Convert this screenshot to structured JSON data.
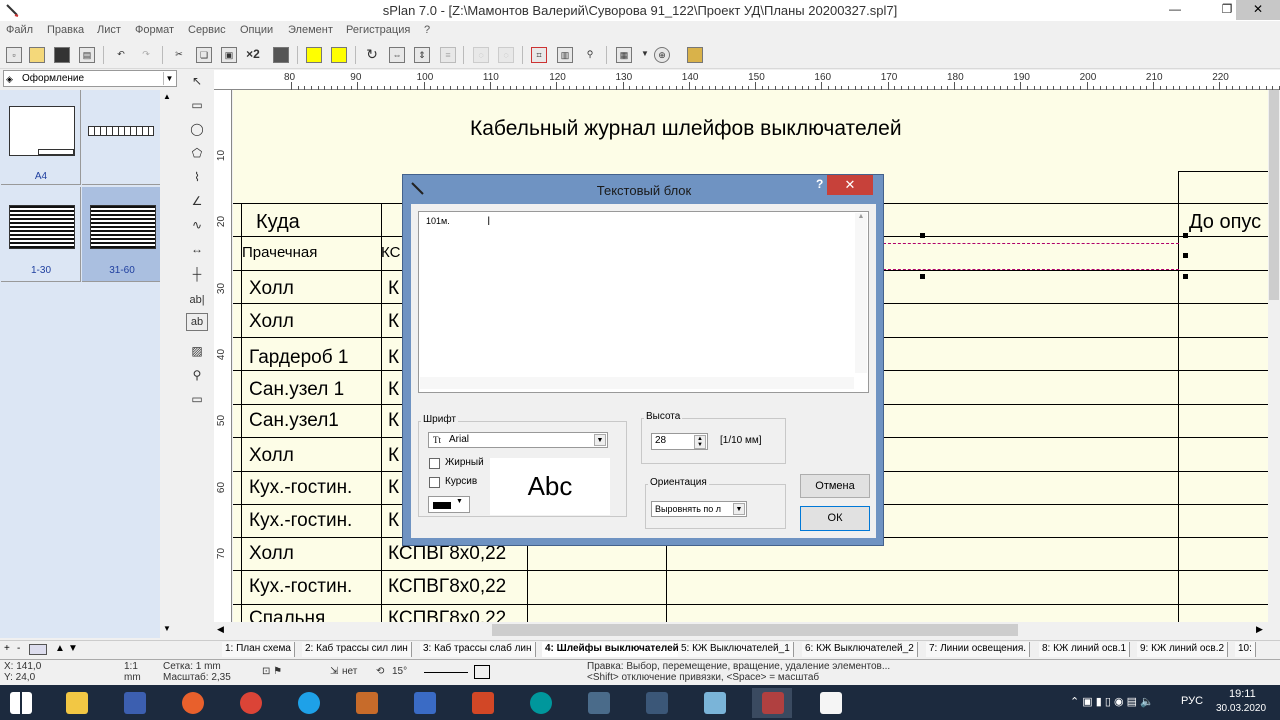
{
  "window": {
    "title": "sPlan 7.0 - [Z:\\Мамонтов Валерий\\Суворова 91_122\\Проект УД\\Планы 20200327.spl7]"
  },
  "menu": [
    "Файл",
    "Правка",
    "Лист",
    "Формат",
    "Сервис",
    "Опции",
    "Элемент",
    "Регистрация",
    "?"
  ],
  "toolbar": {
    "multiply_label": "×2"
  },
  "layer_combo": {
    "value": "Оформление"
  },
  "pages": [
    {
      "label": "A4"
    },
    {
      "label": ""
    },
    {
      "label": "1-30"
    },
    {
      "label": "31-60"
    }
  ],
  "tools": {
    "ab_label": "ab|",
    "ab_box_label": "ab"
  },
  "hruler": [
    "80",
    "90",
    "100",
    "110",
    "120",
    "130",
    "140",
    "150",
    "160",
    "170",
    "180",
    "190",
    "200",
    "210",
    "220"
  ],
  "vruler": [
    "10",
    "20",
    "30",
    "40",
    "50",
    "60",
    "70"
  ],
  "drawing": {
    "title": "Кабельный журнал шлейфов выключателей",
    "col_header_1": "Куда",
    "col_header_2": "До опус",
    "rows": [
      {
        "where": "Прачечная",
        "cable": "КС"
      },
      {
        "where": "Холл",
        "cable": "К"
      },
      {
        "where": "Холл",
        "cable": "К"
      },
      {
        "where": "Гардероб 1",
        "cable": "К"
      },
      {
        "where": "Сан.узел 1",
        "cable": "К"
      },
      {
        "where": "Сан.узел1",
        "cable": "К"
      },
      {
        "where": "Холл",
        "cable": "К"
      },
      {
        "where": "Кух.-гостин.",
        "cable": "К"
      },
      {
        "where": "Кух.-гостин.",
        "cable": "К"
      },
      {
        "where": "Холл",
        "cable": "КСПВГ8х0,22"
      },
      {
        "where": "Кух.-гостин.",
        "cable": "КСПВГ8х0,22"
      },
      {
        "where": "Спальня",
        "cable": "КСПВГ8х0,22"
      }
    ]
  },
  "dialog": {
    "title": "Текстовый блок",
    "help": "?",
    "close": "✕",
    "text_value": "101м.",
    "font_group": "Шрифт",
    "font_value": "Arial",
    "bold_label": "Жирный",
    "italic_label": "Курсив",
    "preview": "Abc",
    "height_group": "Высота",
    "height_value": "28",
    "height_unit": "[1/10 мм]",
    "orient_group": "Ориентация",
    "orient_value": "Выровнять по л",
    "cancel": "Отмена",
    "ok": "ОК"
  },
  "tabs": [
    "1: План схема",
    "2: Каб трассы сил лин",
    "3: Каб трассы слаб лин",
    "4: Шлейфы выключателей",
    "5: КЖ Выключателей_1",
    "6: КЖ Выключателей_2",
    "7: Линии освещения.",
    "8: КЖ линий осв.1",
    "9: КЖ линий осв.2",
    "10:"
  ],
  "status": {
    "x": "X: 141,0",
    "y": "Y: 24,0",
    "scale_ratio": "1:1",
    "scale_unit": "mm",
    "grid": "Сетка: 1 mm",
    "zoom": "Масштаб:  2,35",
    "snap": "нет",
    "angle": "15°",
    "hint1": "Правка: Выбор, перемещение, вращение, удаление элементов...",
    "hint2": "<Shift> отключение привязки, <Space> = масштаб"
  },
  "taskbar": {
    "lang": "РУС",
    "time": "19:11",
    "date": "30.03.2020"
  },
  "colors": {
    "canvas": "#fdfde7",
    "dialog_frame": "#6f93c2",
    "close_red": "#c7413a",
    "taskbar": "#1c2a3e"
  }
}
